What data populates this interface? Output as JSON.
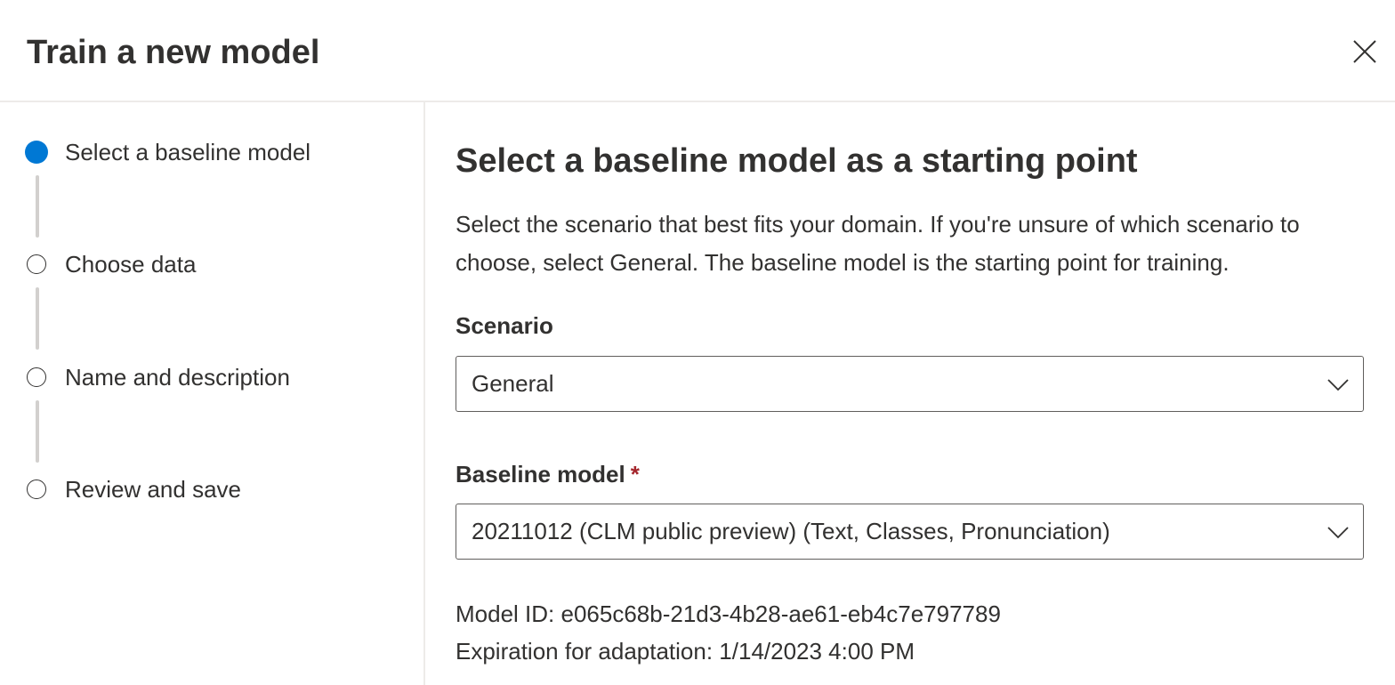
{
  "dialog": {
    "title": "Train a new model",
    "close_icon": "close-icon"
  },
  "steps": [
    {
      "label": "Select a baseline model",
      "state": "active"
    },
    {
      "label": "Choose data",
      "state": "inactive"
    },
    {
      "label": "Name and description",
      "state": "inactive"
    },
    {
      "label": "Review and save",
      "state": "inactive"
    }
  ],
  "main": {
    "title": "Select a baseline model as a starting point",
    "description": "Select the scenario that best fits your domain. If you're unsure of which scenario to choose, select General. The baseline model is the starting point for training.",
    "scenario": {
      "label": "Scenario",
      "value": "General"
    },
    "baseline": {
      "label": "Baseline model",
      "required_mark": "*",
      "value": "20211012 (CLM public preview) (Text, Classes, Pronunciation)"
    },
    "model_id": "Model ID: e065c68b-21d3-4b28-ae61-eb4c7e797789",
    "expiration": "Expiration for adaptation: 1/14/2023 4:00 PM"
  },
  "colors": {
    "accent": "#0078d4",
    "required": "#a4262c",
    "text": "#323130",
    "divider": "#edebe9"
  }
}
